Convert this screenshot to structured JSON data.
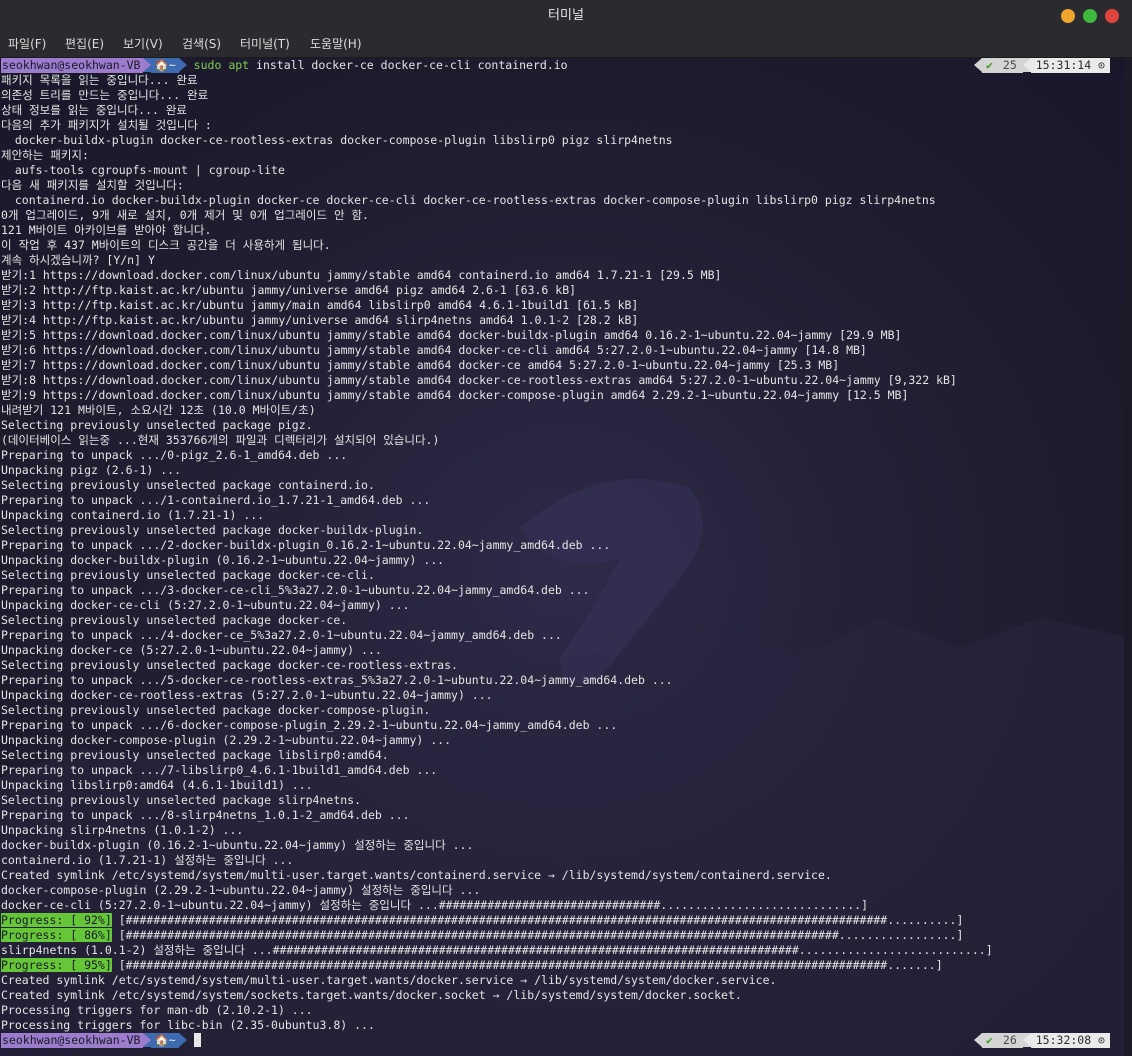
{
  "window": {
    "title": "터미널"
  },
  "colors": {
    "close": "#e0443e",
    "maximize": "#3db83c",
    "minimize": "#f0a52c",
    "prompt_user": "#9c7ccd",
    "prompt_dir": "#3d6ab0",
    "progress": "#65c637"
  },
  "menu": [
    "파일(F)",
    "편집(E)",
    "보기(V)",
    "검색(S)",
    "터미널(T)",
    "도움말(H)"
  ],
  "prompt1": {
    "user": "seokhwan@seokhwan-VB",
    "dir_icon": "home-icon",
    "dir": "🏠~",
    "cmd_sudo": "sudo",
    "cmd_apt": "apt",
    "cmd_rest": "install docker-ce docker-ce-cli containerd.io",
    "status_ok": "✔",
    "history": "25",
    "time": "15:31:14 ⊙"
  },
  "prompt2": {
    "user": "seokhwan@seokhwan-VB",
    "dir": "🏠~",
    "status_ok": "✔",
    "history": "26",
    "time": "15:32:08 ⊙"
  },
  "output": [
    "패키지 목록을 읽는 중입니다... 완료",
    "의존성 트리를 만드는 중입니다... 완료",
    "상태 정보를 읽는 중입니다... 완료",
    "다음의 추가 패키지가 설치될 것입니다 :",
    "  docker-buildx-plugin docker-ce-rootless-extras docker-compose-plugin libslirp0 pigz slirp4netns",
    "제안하는 패키지:",
    "  aufs-tools cgroupfs-mount | cgroup-lite",
    "다음 새 패키지를 설치할 것입니다:",
    "  containerd.io docker-buildx-plugin docker-ce docker-ce-cli docker-ce-rootless-extras docker-compose-plugin libslirp0 pigz slirp4netns",
    "0개 업그레이드, 9개 새로 설치, 0개 제거 및 0개 업그레이드 안 함.",
    "121 M바이트 아카이브를 받아야 합니다.",
    "이 작업 후 437 M바이트의 디스크 공간을 더 사용하게 됩니다.",
    "계속 하시겠습니까? [Y/n] Y",
    "받기:1 https://download.docker.com/linux/ubuntu jammy/stable amd64 containerd.io amd64 1.7.21-1 [29.5 MB]",
    "받기:2 http://ftp.kaist.ac.kr/ubuntu jammy/universe amd64 pigz amd64 2.6-1 [63.6 kB]",
    "받기:3 http://ftp.kaist.ac.kr/ubuntu jammy/main amd64 libslirp0 amd64 4.6.1-1build1 [61.5 kB]",
    "받기:4 http://ftp.kaist.ac.kr/ubuntu jammy/universe amd64 slirp4netns amd64 1.0.1-2 [28.2 kB]",
    "받기:5 https://download.docker.com/linux/ubuntu jammy/stable amd64 docker-buildx-plugin amd64 0.16.2-1~ubuntu.22.04~jammy [29.9 MB]",
    "받기:6 https://download.docker.com/linux/ubuntu jammy/stable amd64 docker-ce-cli amd64 5:27.2.0-1~ubuntu.22.04~jammy [14.8 MB]",
    "받기:7 https://download.docker.com/linux/ubuntu jammy/stable amd64 docker-ce amd64 5:27.2.0-1~ubuntu.22.04~jammy [25.3 MB]",
    "받기:8 https://download.docker.com/linux/ubuntu jammy/stable amd64 docker-ce-rootless-extras amd64 5:27.2.0-1~ubuntu.22.04~jammy [9,322 kB]",
    "받기:9 https://download.docker.com/linux/ubuntu jammy/stable amd64 docker-compose-plugin amd64 2.29.2-1~ubuntu.22.04~jammy [12.5 MB]",
    "내려받기 121 M바이트, 소요시간 12초 (10.0 M바이트/초)",
    "Selecting previously unselected package pigz.",
    "(데이터베이스 읽는중 ...현재 353766개의 파일과 디렉터리가 설치되어 있습니다.)",
    "Preparing to unpack .../0-pigz_2.6-1_amd64.deb ...",
    "Unpacking pigz (2.6-1) ...",
    "Selecting previously unselected package containerd.io.",
    "Preparing to unpack .../1-containerd.io_1.7.21-1_amd64.deb ...",
    "Unpacking containerd.io (1.7.21-1) ...",
    "Selecting previously unselected package docker-buildx-plugin.",
    "Preparing to unpack .../2-docker-buildx-plugin_0.16.2-1~ubuntu.22.04~jammy_amd64.deb ...",
    "Unpacking docker-buildx-plugin (0.16.2-1~ubuntu.22.04~jammy) ...",
    "Selecting previously unselected package docker-ce-cli.",
    "Preparing to unpack .../3-docker-ce-cli_5%3a27.2.0-1~ubuntu.22.04~jammy_amd64.deb ...",
    "Unpacking docker-ce-cli (5:27.2.0-1~ubuntu.22.04~jammy) ...",
    "Selecting previously unselected package docker-ce.",
    "Preparing to unpack .../4-docker-ce_5%3a27.2.0-1~ubuntu.22.04~jammy_amd64.deb ...",
    "Unpacking docker-ce (5:27.2.0-1~ubuntu.22.04~jammy) ...",
    "Selecting previously unselected package docker-ce-rootless-extras.",
    "Preparing to unpack .../5-docker-ce-rootless-extras_5%3a27.2.0-1~ubuntu.22.04~jammy_amd64.deb ...",
    "Unpacking docker-ce-rootless-extras (5:27.2.0-1~ubuntu.22.04~jammy) ...",
    "Selecting previously unselected package docker-compose-plugin.",
    "Preparing to unpack .../6-docker-compose-plugin_2.29.2-1~ubuntu.22.04~jammy_amd64.deb ...",
    "Unpacking docker-compose-plugin (2.29.2-1~ubuntu.22.04~jammy) ...",
    "Selecting previously unselected package libslirp0:amd64.",
    "Preparing to unpack .../7-libslirp0_4.6.1-1build1_amd64.deb ...",
    "Unpacking libslirp0:amd64 (4.6.1-1build1) ...",
    "Selecting previously unselected package slirp4netns.",
    "Preparing to unpack .../8-slirp4netns_1.0.1-2_amd64.deb ...",
    "Unpacking slirp4netns (1.0.1-2) ...",
    "docker-buildx-plugin (0.16.2-1~ubuntu.22.04~jammy) 설정하는 중입니다 ...",
    "containerd.io (1.7.21-1) 설정하는 중입니다 ...",
    "Created symlink /etc/systemd/system/multi-user.target.wants/containerd.service → /lib/systemd/system/containerd.service.",
    "docker-compose-plugin (2.29.2-1~ubuntu.22.04~jammy) 설정하는 중입니다 ...",
    "docker-ce-cli (5:27.2.0-1~ubuntu.22.04~jammy) 설정하는 중입니다 ...################################.............................]",
    "Progress: [ 92%]| [##############################################################################################################..........]",
    "Progress: [ 86%]| [#######################################################################################################.................]",
    "slirp4netns (1.0.1-2) 설정하는 중입니다 ...############################################################################...........................]",
    "Progress: [ 95%]| [##############################################################################################################.......]",
    "Created symlink /etc/systemd/system/multi-user.target.wants/docker.service → /lib/systemd/system/docker.service.",
    "Created symlink /etc/systemd/system/sockets.target.wants/docker.socket → /lib/systemd/system/docker.socket.",
    "Processing triggers for man-db (2.10.2-1) ...",
    "Processing triggers for libc-bin (2.35-0ubuntu3.8) ..."
  ]
}
